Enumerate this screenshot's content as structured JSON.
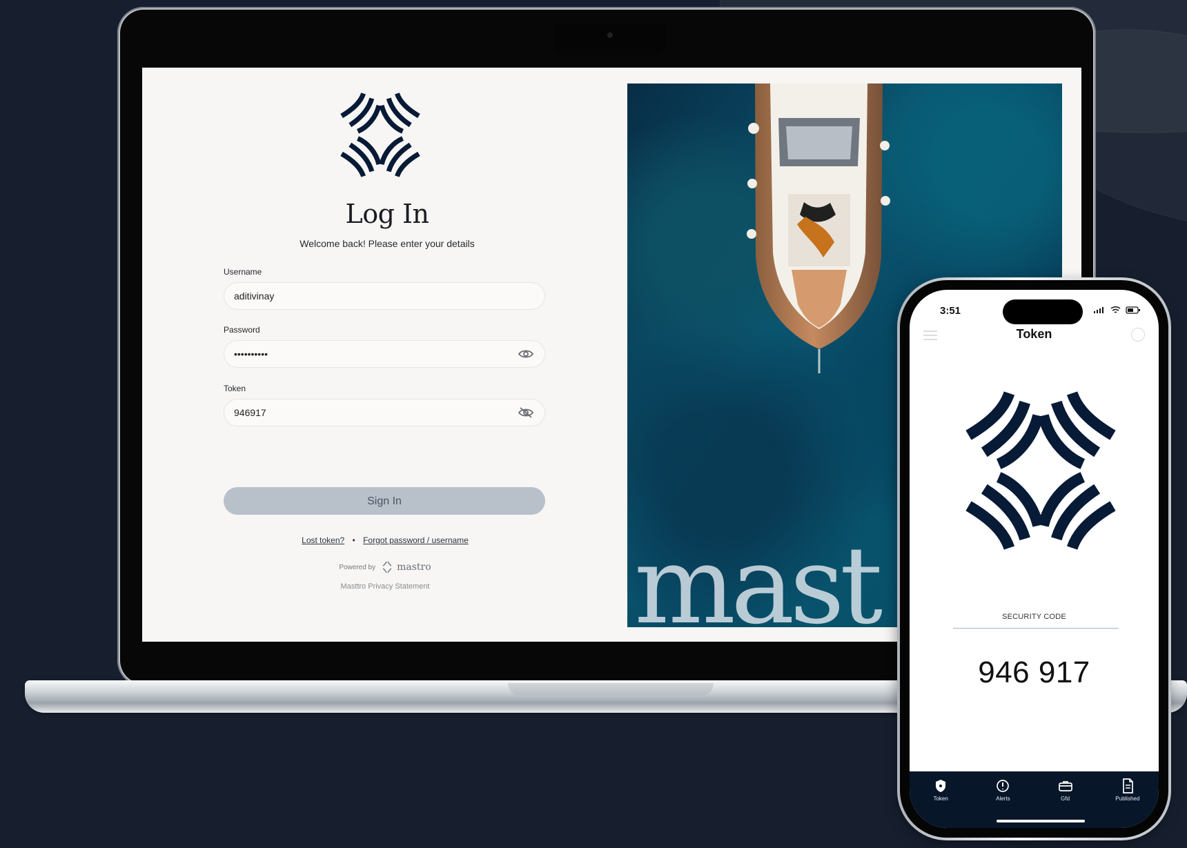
{
  "login": {
    "title": "Log In",
    "subtitle": "Welcome back! Please enter your details",
    "username": {
      "label": "Username",
      "value": "aditivinay"
    },
    "password": {
      "label": "Password",
      "value": "••••••••••",
      "icon": "eye-icon"
    },
    "token": {
      "label": "Token",
      "value": "946917",
      "icon": "eye-off-icon"
    },
    "sign_in_label": "Sign In",
    "lost_token_label": "Lost token?",
    "separator": "•",
    "forgot_label": "Forgot password / username",
    "powered_by": "Powered by",
    "powered_brand": "mastro",
    "privacy_label": "Masttro Privacy Statement"
  },
  "hero": {
    "wordmark": "mast"
  },
  "phone": {
    "time": "3:51",
    "title": "Token",
    "security_label": "SECURITY CODE",
    "security_code": "946 917",
    "tabs": [
      {
        "label": "Token",
        "icon": "shield-icon"
      },
      {
        "label": "Alerts",
        "icon": "alert-icon"
      },
      {
        "label": "Gfd",
        "icon": "briefcase-icon"
      },
      {
        "label": "Published",
        "icon": "document-icon"
      }
    ]
  },
  "colors": {
    "background": "#171f2f",
    "navy_logo": "#071a36",
    "button": "#b8c0ca",
    "ocean": "#0a5570",
    "phone_tabbar": "#071629"
  }
}
